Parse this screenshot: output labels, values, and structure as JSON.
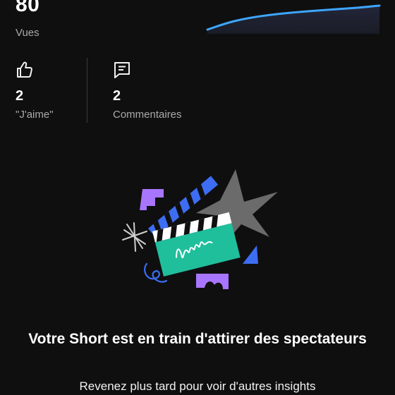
{
  "views": {
    "value": "80",
    "label": "Vues"
  },
  "likes": {
    "icon": "thumbs-up-icon",
    "value": "2",
    "label": "\"J'aime\""
  },
  "comments": {
    "icon": "comment-icon",
    "value": "2",
    "label": "Commentaires"
  },
  "empty_state": {
    "illustration": "clapperboard-illustration",
    "title": "Votre Short est en train d'attirer des spectateurs",
    "subtitle": "Revenez plus tard pour voir d'autres insights"
  },
  "colors": {
    "background": "#0f0f0f",
    "sparkline": "#3ea6ff",
    "clapper_green": "#1fbf9c",
    "accent_purple": "#a875ff",
    "accent_blue": "#3d6df2"
  }
}
